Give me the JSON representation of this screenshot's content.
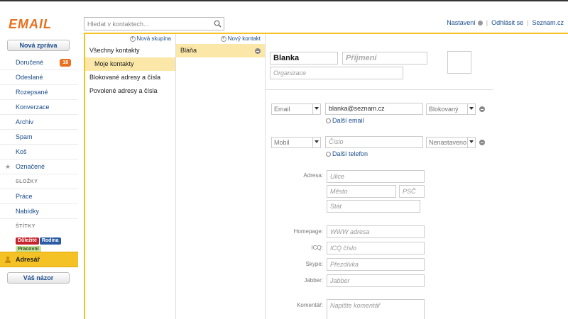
{
  "logo": "EMAIL",
  "search": {
    "placeholder": "Hledat v kontaktech..."
  },
  "toplinks": {
    "settings": "Nastavení",
    "logout": "Odhlásit se",
    "seznam": "Seznam.cz"
  },
  "sidebar": {
    "new_message": "Nová zpráva",
    "items": [
      {
        "label": "Doručené",
        "badge": "18"
      },
      {
        "label": "Odeslané"
      },
      {
        "label": "Rozepsané"
      },
      {
        "label": "Konverzace"
      },
      {
        "label": "Archiv"
      },
      {
        "label": "Spam"
      },
      {
        "label": "Koš"
      },
      {
        "label": "Označené"
      }
    ],
    "folders_title": "SLOŽKY",
    "folders": [
      {
        "label": "Práce"
      },
      {
        "label": "Nabídky"
      }
    ],
    "labels_title": "ŠTÍTKY",
    "tags": [
      {
        "label": "Důležité",
        "color": "#c5232b"
      },
      {
        "label": "Rodina",
        "color": "#2a5ba3"
      },
      {
        "label": "Pracovní",
        "color": "#c8e3a1"
      }
    ],
    "address_book": "Adresář",
    "feedback": "Váš názor"
  },
  "groups": {
    "new_group": "Nová skupina",
    "items": [
      {
        "label": "Všechny kontakty"
      },
      {
        "label": "Moje kontakty",
        "selected": true
      },
      {
        "label": "Blokované adresy a čísla"
      },
      {
        "label": "Povolené adresy a čísla"
      }
    ]
  },
  "contacts": {
    "new_contact": "Nový kontakt",
    "items": [
      {
        "label": "Bláňa",
        "selected": true
      }
    ]
  },
  "detail": {
    "first_name": "Blanka",
    "last_name_placeholder": "Příjmení",
    "organization_placeholder": "Organizace",
    "email_type": "Email",
    "email_value": "blanka@seznam.cz",
    "email_status": "Blokovaný",
    "add_email": "Další email",
    "phone_type": "Mobil",
    "phone_placeholder": "Číslo",
    "phone_status": "Nenastaveno",
    "add_phone": "Další telefon",
    "address_label": "Adresa:",
    "street_placeholder": "Ulice",
    "city_placeholder": "Město",
    "zip_placeholder": "PSČ",
    "state_placeholder": "Stát",
    "homepage_label": "Homepage:",
    "homepage_placeholder": "WWW adresa",
    "icq_label": "ICQ:",
    "icq_placeholder": "ICQ číslo",
    "skype_label": "Skype:",
    "skype_placeholder": "Přezdívka",
    "jabber_label": "Jabber:",
    "jabber_placeholder": "Jabber",
    "comment_label": "Komentář:",
    "comment_placeholder": "Napište komentář"
  },
  "colors": {
    "accent": "#f5c225",
    "brand": "#e8701e",
    "link": "#1a4c8c"
  }
}
